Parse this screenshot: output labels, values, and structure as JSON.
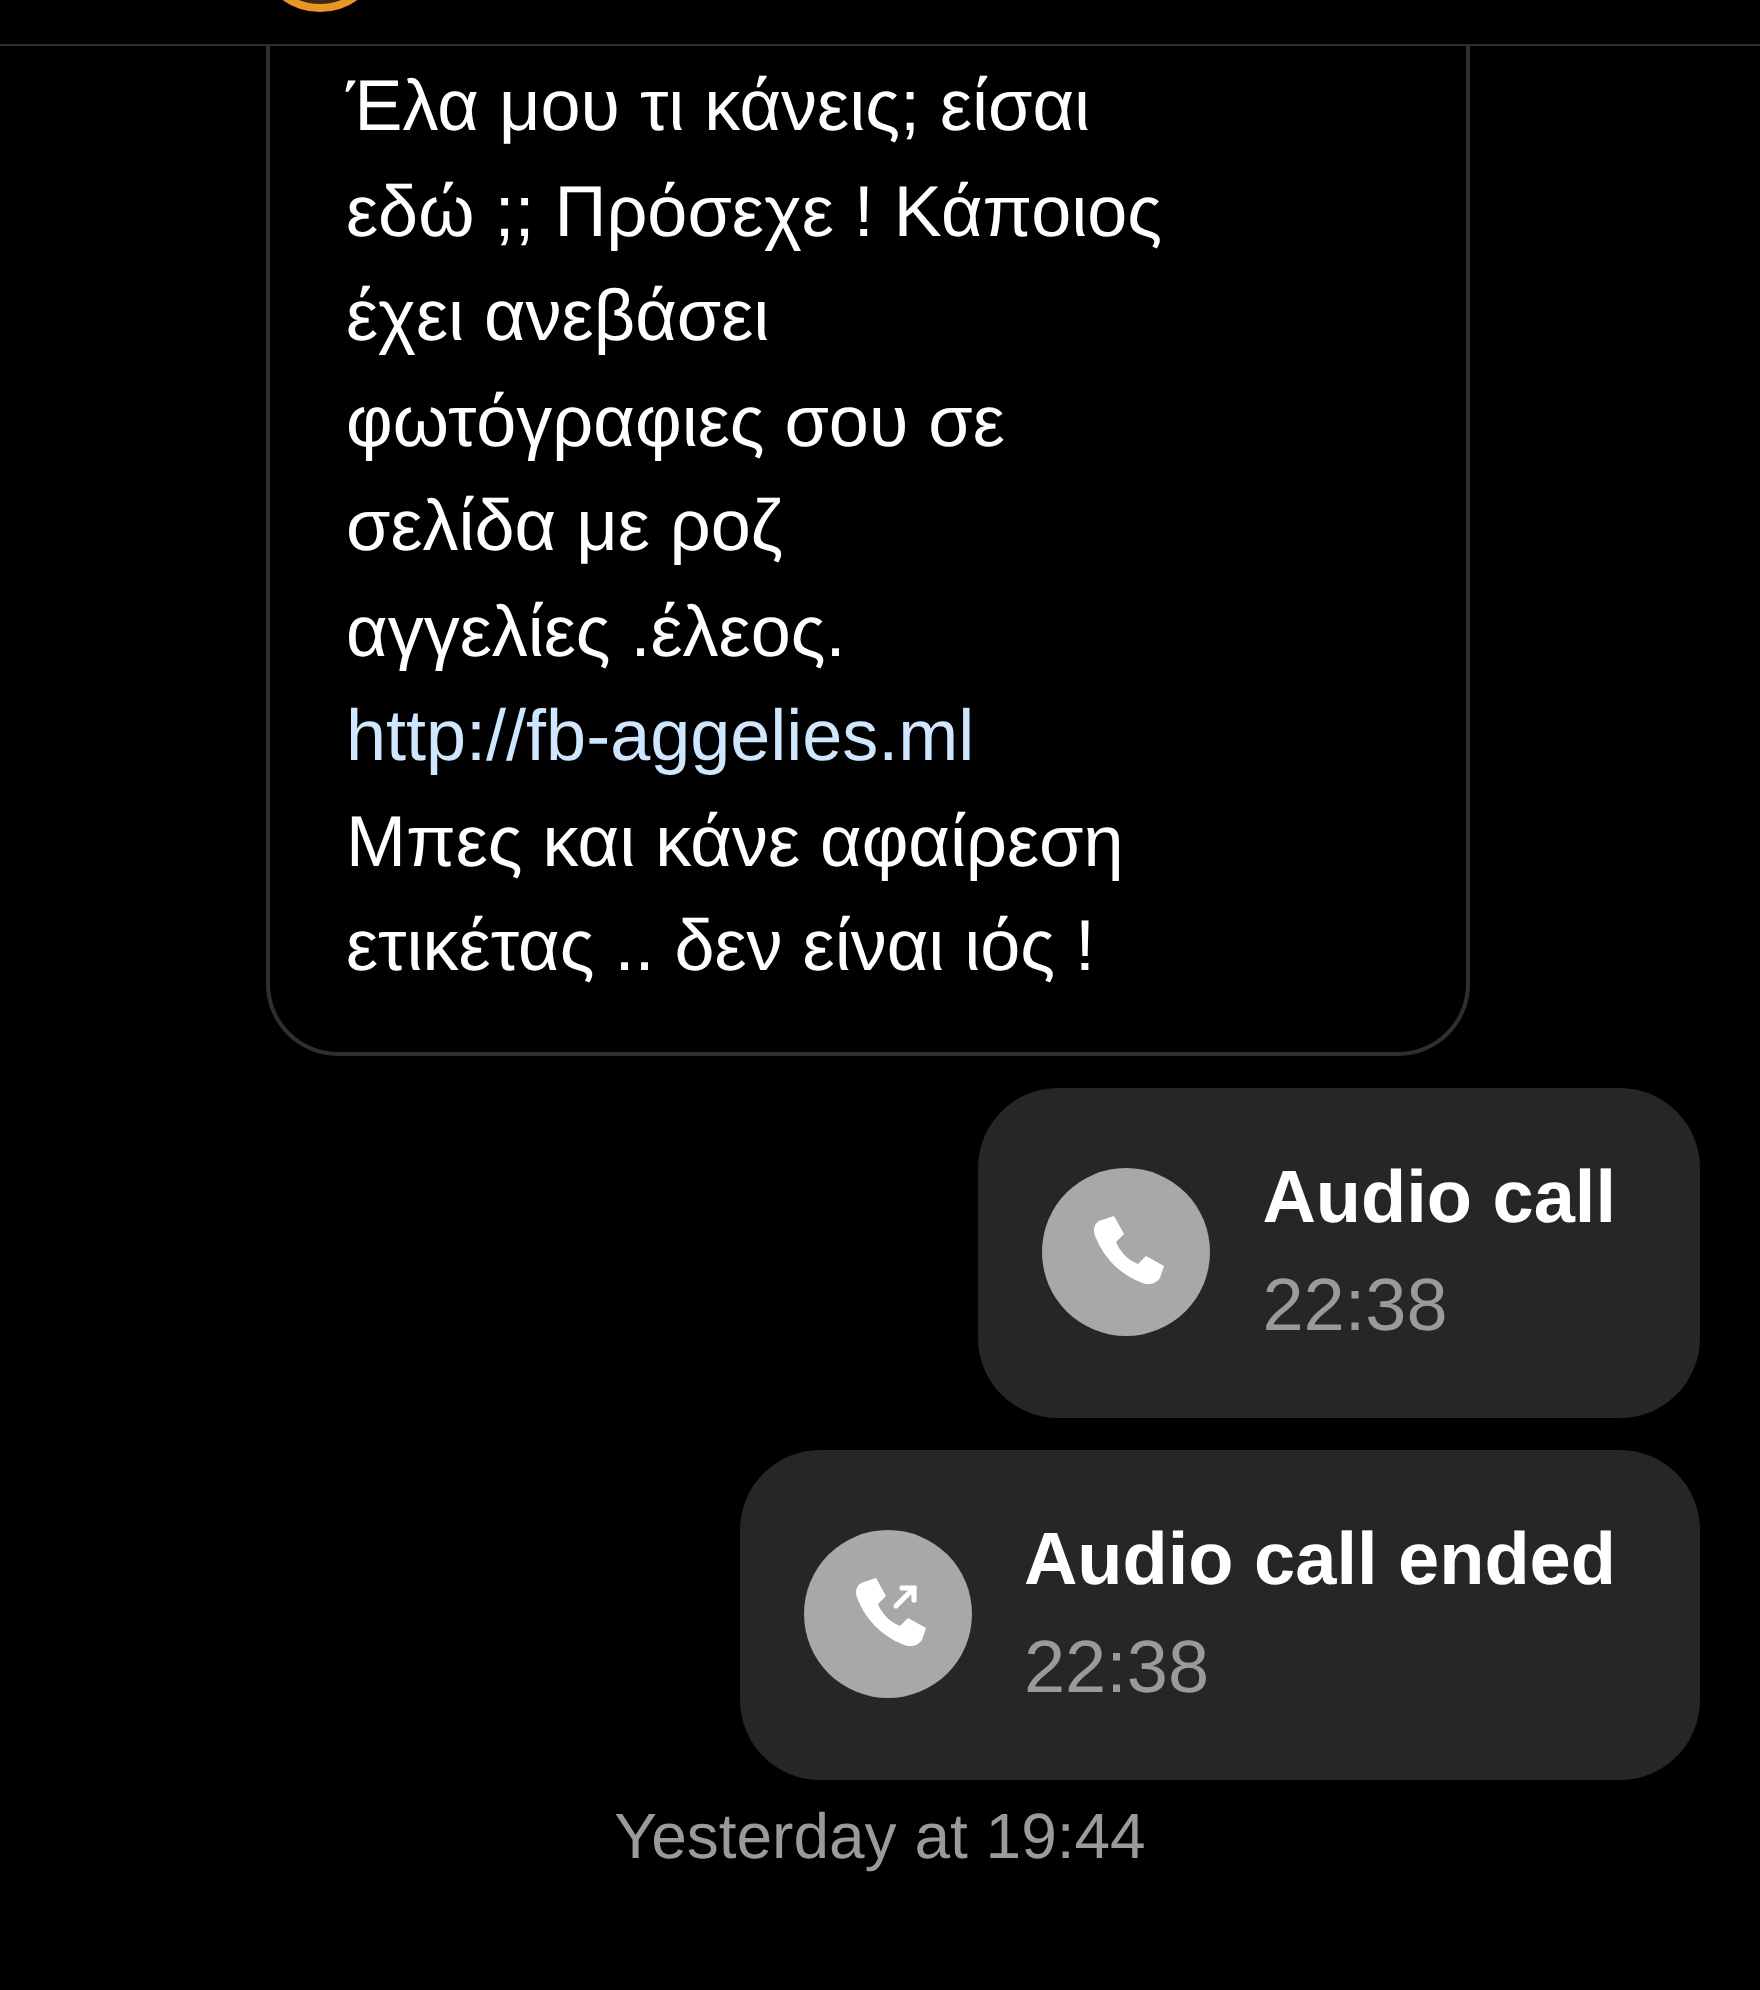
{
  "messages": [
    {
      "kind": "text",
      "lines": [
        {
          "kind": "text",
          "text": "Έλα μου τι κάνεις; είσαι"
        },
        {
          "kind": "text",
          "text": "εδώ ;; Πρόσεχε ! Κάποιος"
        },
        {
          "kind": "text",
          "text": "έχει ανεβάσει"
        },
        {
          "kind": "text",
          "text": "φωτόγραφιες σου σε"
        },
        {
          "kind": "text",
          "text": "σελίδα με ροζ"
        },
        {
          "kind": "text",
          "text": "αγγελίες .έλεος."
        },
        {
          "kind": "link",
          "text": "http://fb-aggelies.ml"
        },
        {
          "kind": "text",
          "text": "Μπες και κάνε αφαίρεση"
        },
        {
          "kind": "text",
          "text": "ετικέτας .. δεν είναι ιός !"
        }
      ]
    },
    {
      "kind": "call",
      "title": "Audio call",
      "time": "22:38",
      "ended": false
    },
    {
      "kind": "call",
      "title": "Audio call ended",
      "time": "22:38",
      "ended": true
    }
  ],
  "date_separator": "Yesterday at 19:44"
}
